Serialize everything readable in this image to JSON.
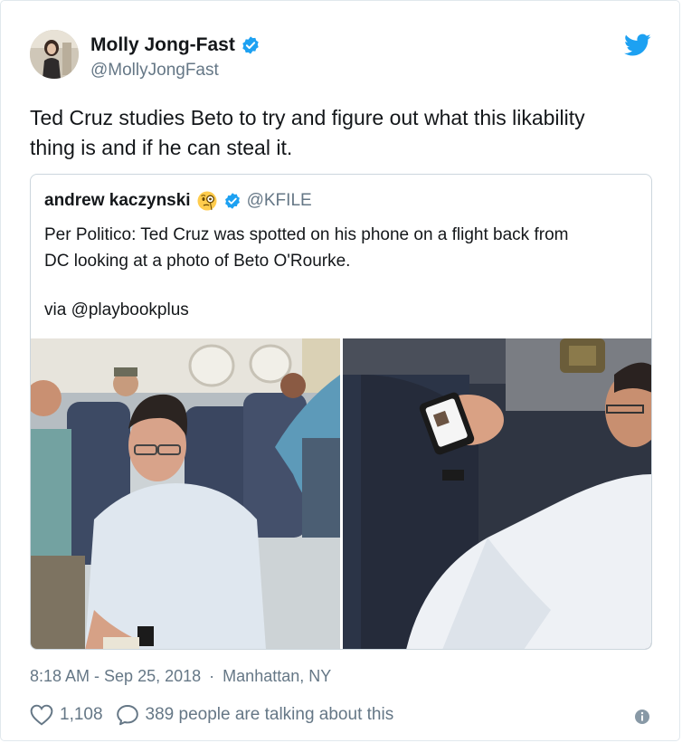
{
  "author": {
    "display_name": "Molly Jong-Fast",
    "handle": "@MollyJongFast",
    "verified": true
  },
  "tweet": {
    "text_line1": "Ted Cruz studies Beto to try and figure out what this likability",
    "text_line2": "thing is and if he can steal it."
  },
  "quoted": {
    "display_name": "andrew kaczynski",
    "emoji": "face-with-monocle-icon",
    "handle": "@KFILE",
    "text_line1": "Per Politico: Ted Cruz was spotted on his phone on a flight back from",
    "text_line2": "DC looking at a photo of Beto O'Rourke.",
    "via": "via @playbookplus"
  },
  "meta": {
    "timestamp": "8:18 AM - Sep 25, 2018",
    "separator": "·",
    "location": "Manhattan, NY"
  },
  "actions": {
    "likes": "1,108",
    "talking": "389 people are talking about this"
  },
  "colors": {
    "twitter_blue": "#1da1f2",
    "text": "#14171a",
    "secondary": "#657786",
    "border": "#e1e8ed"
  },
  "icons": [
    "twitter-bird-icon",
    "verified-badge-icon",
    "heart-icon",
    "reply-bubble-icon",
    "info-icon"
  ]
}
